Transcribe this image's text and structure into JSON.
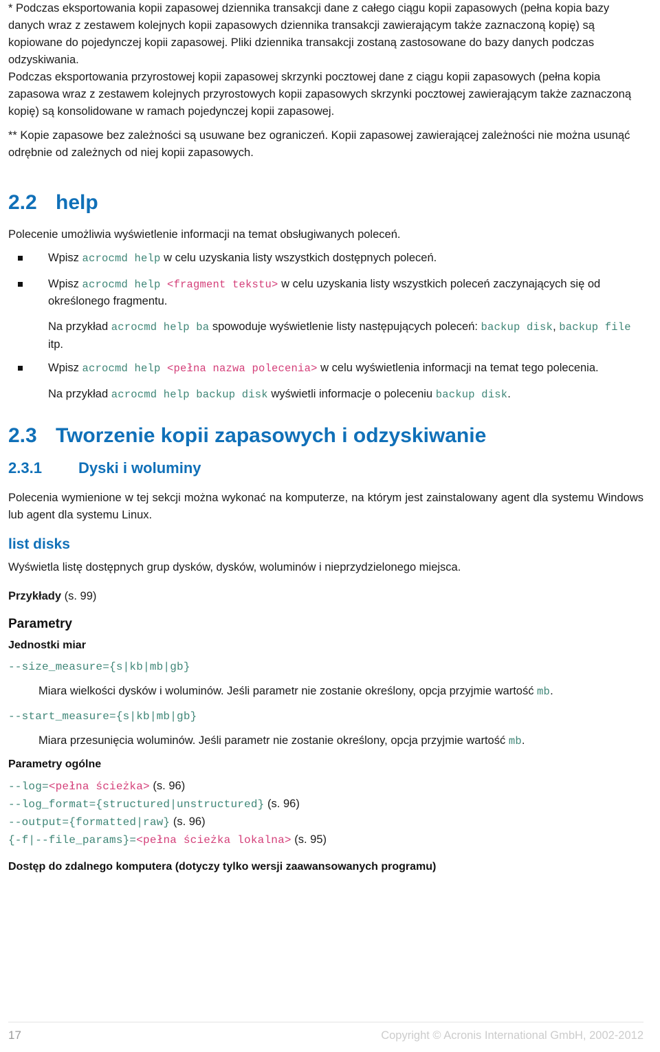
{
  "colors": {
    "heading_blue": "#1070b8",
    "code_green": "#3f8677",
    "code_pink": "#d43f79",
    "footer_gray": "#cccccc",
    "pageno_gray": "#9b9b9b",
    "body_black": "#1b1b1b"
  },
  "notes": {
    "footnote_star": "* Podczas eksportowania kopii zapasowej dziennika transakcji dane z całego ciągu kopii zapasowych (pełna kopia bazy danych wraz z zestawem kolejnych kopii zapasowych dziennika transakcji zawierającym także zaznaczoną kopię) są kopiowane do pojedynczej kopii zapasowej. Pliki dziennika transakcji zostaną zastosowane do bazy danych podczas odzyskiwania.",
    "footnote_star_second": "Podczas eksportowania przyrostowej kopii zapasowej skrzynki pocztowej dane z ciągu kopii zapasowych (pełna kopia zapasowa wraz z zestawem kolejnych przyrostowych kopii zapasowych skrzynki pocztowej zawierającym także zaznaczoną kopię) są konsolidowane w ramach pojedynczej kopii zapasowej.",
    "footnote_double_star": "** Kopie zapasowe bez zależności są usuwane bez ograniczeń. Kopii zapasowej zawierającej zależności nie można usunąć odrębnie od zależnych od niej kopii zapasowych."
  },
  "section_help": {
    "number": "2.2",
    "title": "help",
    "intro": "Polecenie umożliwia wyświetlenie informacji na temat obsługiwanych poleceń.",
    "bullets": [
      {
        "pre": "Wpisz ",
        "code": "acrocmd help",
        "post": " w celu uzyskania listy wszystkich dostępnych poleceń."
      },
      {
        "pre": "Wpisz ",
        "code": "acrocmd help ",
        "placeholder": "<fragment tekstu>",
        "post": " w celu uzyskania listy wszystkich poleceń zaczynających się od określonego fragmentu.",
        "example_pre": "Na przykład ",
        "example_code": "acrocmd help ba",
        "example_mid": " spowoduje wyświetlenie listy następujących poleceń: ",
        "example_code2": "backup disk",
        "example_mid2": ", ",
        "example_code3": "backup file",
        "example_post": " itp."
      },
      {
        "pre": "Wpisz ",
        "code": "acrocmd help ",
        "placeholder": "<pełna nazwa polecenia>",
        "post": " w celu wyświetlenia informacji na temat tego polecenia.",
        "example_pre": "Na przykład ",
        "example_code": "acrocmd help backup disk",
        "example_mid": "  wyświetli informacje o poleceniu ",
        "example_code2": "backup disk",
        "example_post": "."
      }
    ]
  },
  "section_backup": {
    "number": "2.3",
    "title": "Tworzenie kopii zapasowych i odzyskiwanie",
    "subsection": {
      "number": "2.3.1",
      "title": "Dyski i woluminy",
      "intro": "Polecenia wymienione w tej sekcji można wykonać na komputerze, na którym jest zainstalowany agent dla systemu Windows lub agent dla systemu Linux."
    }
  },
  "command": {
    "name": "list disks",
    "description": "Wyświetla listę dostępnych grup dysków, dysków, woluminów i nieprzydzielonego miejsca.",
    "examples_label": "Przykłady",
    "examples_ref": " (s. 99)",
    "parameters_heading": "Parametry",
    "units_heading": "Jednostki miar",
    "params": [
      {
        "syntax": "--size_measure={s|kb|mb|gb}",
        "desc_pre": "Miara wielkości dysków i woluminów. Jeśli parametr nie zostanie określony, opcja przyjmie wartość ",
        "desc_code": "mb",
        "desc_post": "."
      },
      {
        "syntax": "--start_measure={s|kb|mb|gb}",
        "desc_pre": "Miara przesunięcia woluminów. Jeśli parametr nie zostanie określony, opcja przyjmie wartość ",
        "desc_code": "mb",
        "desc_post": "."
      }
    ],
    "general_params_heading": "Parametry ogólne",
    "general_params": [
      {
        "code": "--log=",
        "placeholder": "<pełna ścieżka>",
        "code_after": "",
        "ref": " (s. 96)"
      },
      {
        "code": "--log_format={structured|unstructured}",
        "placeholder": "",
        "code_after": "",
        "ref": " (s. 96)"
      },
      {
        "code": "--output={formatted|raw}",
        "placeholder": "",
        "code_after": "",
        "ref": " (s. 96)"
      },
      {
        "code": "{-f|--file_params}=",
        "placeholder": "<pełna ścieżka lokalna>",
        "code_after": "",
        "ref": " (s. 95)"
      }
    ],
    "remote_access_heading": "Dostęp do zdalnego komputera (dotyczy tylko wersji zaawansowanych programu)"
  },
  "footer": {
    "page_number": "17",
    "copyright": "Copyright © Acronis International GmbH, 2002-2012"
  }
}
